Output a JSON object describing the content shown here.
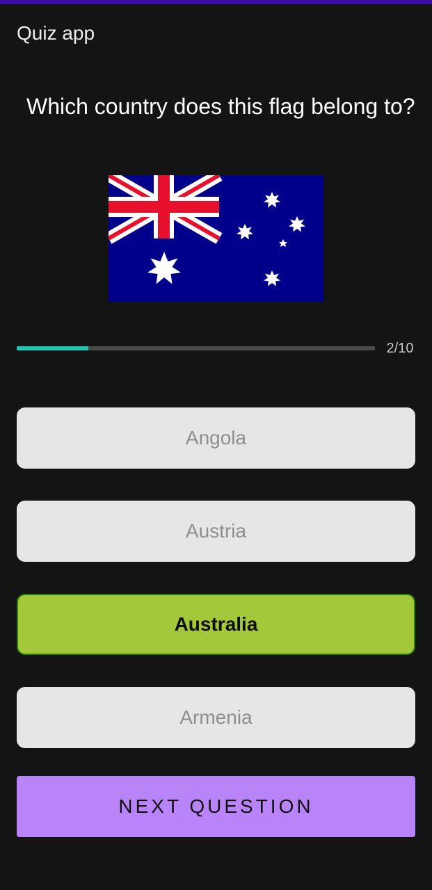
{
  "app": {
    "title": "Quiz app",
    "accent_color": "#3a0ca3"
  },
  "question": {
    "text": "Which country does this flag belong to?",
    "flag_icon": "australia-flag"
  },
  "progress": {
    "current": 2,
    "total": 10,
    "label": "2/10",
    "fraction": 0.2,
    "color": "#21c6b4"
  },
  "options": [
    {
      "label": "Angola",
      "selected": false
    },
    {
      "label": "Austria",
      "selected": false
    },
    {
      "label": "Australia",
      "selected": true
    },
    {
      "label": "Armenia",
      "selected": false
    }
  ],
  "selected_color": "#a3c83a",
  "next_button": {
    "label": "NEXT QUESTION",
    "color": "#b884f7"
  }
}
